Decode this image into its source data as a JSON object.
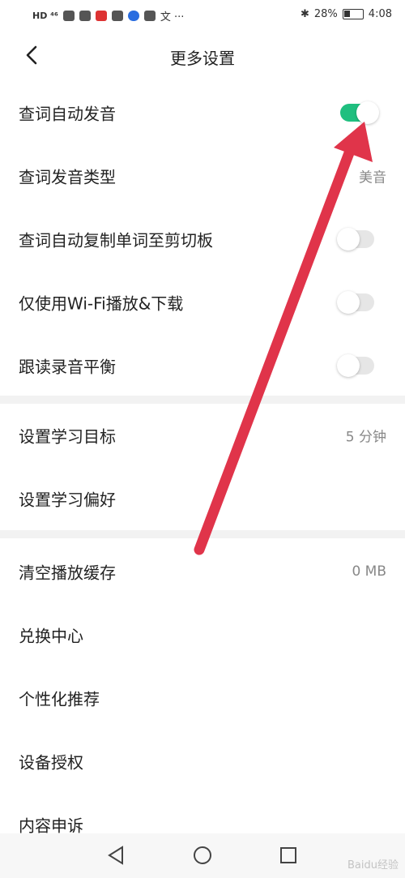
{
  "status_bar": {
    "left_text": "HD ⁴⁶",
    "battery": "28%",
    "time": "4:08",
    "bluetooth": "✱"
  },
  "header": {
    "title": "更多设置"
  },
  "settings": {
    "section1": [
      {
        "label": "查词自动发音",
        "toggle": true
      },
      {
        "label": "查词发音类型",
        "value": "美音"
      },
      {
        "label": "查词自动复制单词至剪切板",
        "toggle": false
      },
      {
        "label": "仅使用Wi-Fi播放&下载",
        "toggle": false
      },
      {
        "label": "跟读录音平衡",
        "toggle": false
      }
    ],
    "section2": [
      {
        "label": "设置学习目标",
        "value": "5 分钟"
      },
      {
        "label": "设置学习偏好"
      }
    ],
    "section3": [
      {
        "label": "清空播放缓存",
        "value": "0 MB"
      },
      {
        "label": "兑换中心"
      },
      {
        "label": "个性化推荐"
      },
      {
        "label": "设备授权"
      },
      {
        "label": "内容申诉"
      }
    ]
  },
  "colors": {
    "toggle_on": "#1fbf7f",
    "annotation_arrow": "#e0344a"
  },
  "watermark": "Baidu经验"
}
